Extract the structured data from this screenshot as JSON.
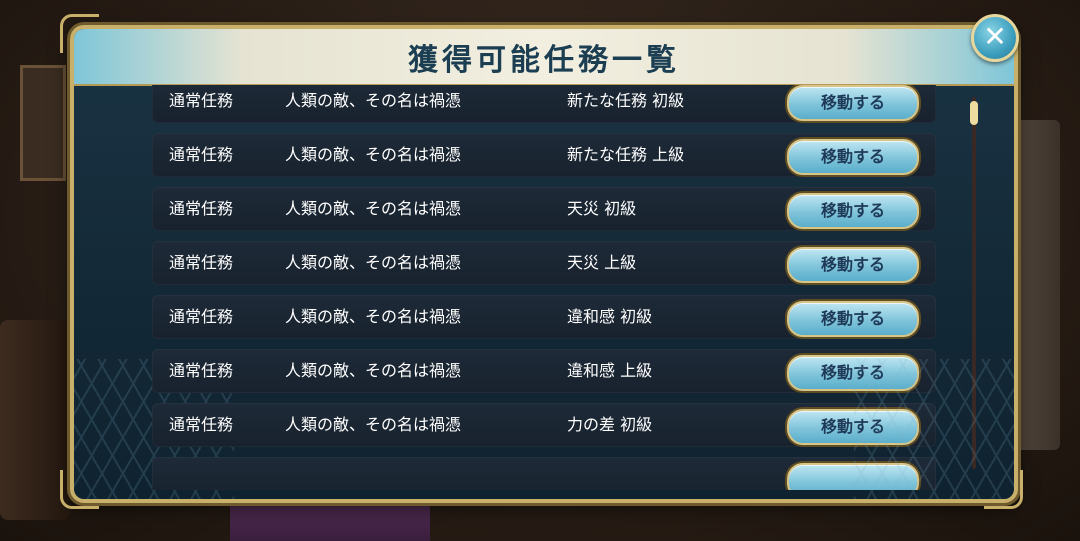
{
  "title": "獲得可能任務一覧",
  "close_label": "✕",
  "rows": [
    {
      "type": "通常任務",
      "event": "人類の敵、その名は禍憑",
      "mission": "新たな任務 初級",
      "button": "移動する"
    },
    {
      "type": "通常任務",
      "event": "人類の敵、その名は禍憑",
      "mission": "新たな任務 上級",
      "button": "移動する"
    },
    {
      "type": "通常任務",
      "event": "人類の敵、その名は禍憑",
      "mission": "天災 初級",
      "button": "移動する"
    },
    {
      "type": "通常任務",
      "event": "人類の敵、その名は禍憑",
      "mission": "天災 上級",
      "button": "移動する"
    },
    {
      "type": "通常任務",
      "event": "人類の敵、その名は禍憑",
      "mission": "違和感 初級",
      "button": "移動する"
    },
    {
      "type": "通常任務",
      "event": "人類の敵、その名は禍憑",
      "mission": "違和感 上級",
      "button": "移動する"
    },
    {
      "type": "通常任務",
      "event": "人類の敵、その名は禍憑",
      "mission": "力の差 初級",
      "button": "移動する"
    },
    {
      "type": "",
      "event": "",
      "mission": "",
      "button": ""
    }
  ],
  "colors": {
    "accent": "#7fc4da",
    "frame": "#c9b06a",
    "panel": "#132836",
    "title_text": "#1c3e52"
  }
}
